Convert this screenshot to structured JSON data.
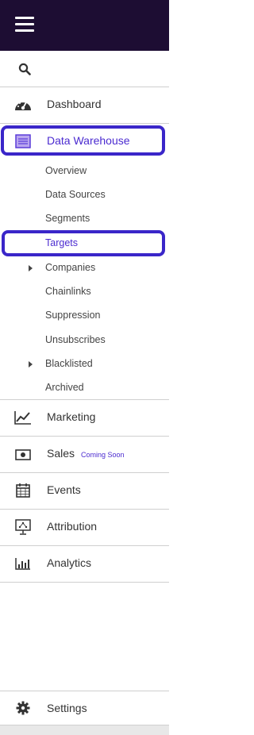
{
  "topbar": {
    "menu_icon": "hamburger-icon"
  },
  "search": {
    "icon": "search-icon"
  },
  "nav": {
    "dashboard": {
      "label": "Dashboard",
      "icon": "speedometer-icon"
    },
    "data_warehouse": {
      "label": "Data Warehouse",
      "icon": "database-icon"
    },
    "marketing": {
      "label": "Marketing",
      "icon": "trend-chart-icon"
    },
    "sales": {
      "label": "Sales",
      "badge": "Coming Soon",
      "icon": "cash-icon"
    },
    "events": {
      "label": "Events",
      "icon": "calendar-icon"
    },
    "attribution": {
      "label": "Attribution",
      "icon": "presentation-icon"
    },
    "analytics": {
      "label": "Analytics",
      "icon": "bar-chart-icon"
    },
    "settings": {
      "label": "Settings",
      "icon": "gear-icon"
    }
  },
  "data_warehouse_items": [
    {
      "label": "Overview"
    },
    {
      "label": "Data Sources"
    },
    {
      "label": "Segments"
    },
    {
      "label": "Targets",
      "active": true
    },
    {
      "label": "Companies",
      "expandable": true
    },
    {
      "label": "Chainlinks"
    },
    {
      "label": "Suppression"
    },
    {
      "label": "Unsubscribes"
    },
    {
      "label": "Blacklisted",
      "expandable": true
    },
    {
      "label": "Archived"
    }
  ],
  "colors": {
    "topbar": "#1d0d33",
    "accent": "#4b2bd0",
    "highlight_border": "#3a26c9"
  }
}
